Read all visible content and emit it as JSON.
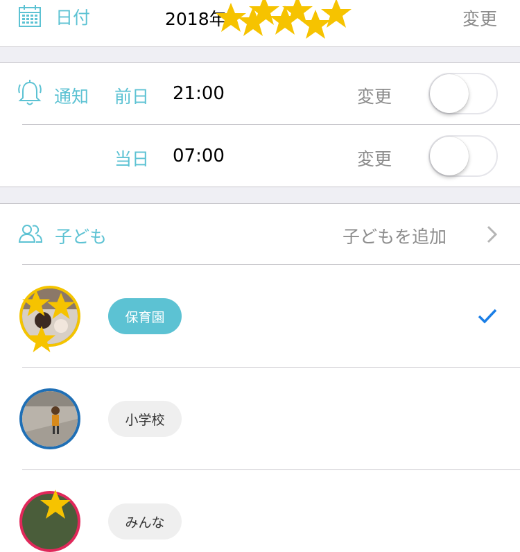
{
  "date_row": {
    "label": "日付",
    "value": "2018年",
    "action": "変更",
    "icon": "calendar-icon"
  },
  "notification": {
    "label": "通知",
    "icon": "bell-icon",
    "rows": [
      {
        "day": "前日",
        "time": "21:00",
        "action": "変更",
        "enabled": false
      },
      {
        "day": "当日",
        "time": "07:00",
        "action": "変更",
        "enabled": false
      }
    ]
  },
  "children": {
    "label": "子ども",
    "icon": "children-icon",
    "add_label": "子どもを追加",
    "items": [
      {
        "tag": "保育園",
        "selected": true,
        "ring_color": "#f4c400",
        "tag_bg": "#5cc2d3",
        "tag_color": "#ffffff"
      },
      {
        "tag": "小学校",
        "selected": false,
        "ring_color": "#1f6fb5",
        "tag_bg": "#efefef",
        "tag_color": "#333333"
      },
      {
        "tag": "みんな",
        "selected": false,
        "ring_color": "#e0285a",
        "tag_bg": "#efefef",
        "tag_color": "#333333"
      }
    ]
  },
  "colors": {
    "accent": "#5cc2d3",
    "check": "#1a7ee6",
    "separator_bg": "#efeff4",
    "star": "#f6c300"
  }
}
